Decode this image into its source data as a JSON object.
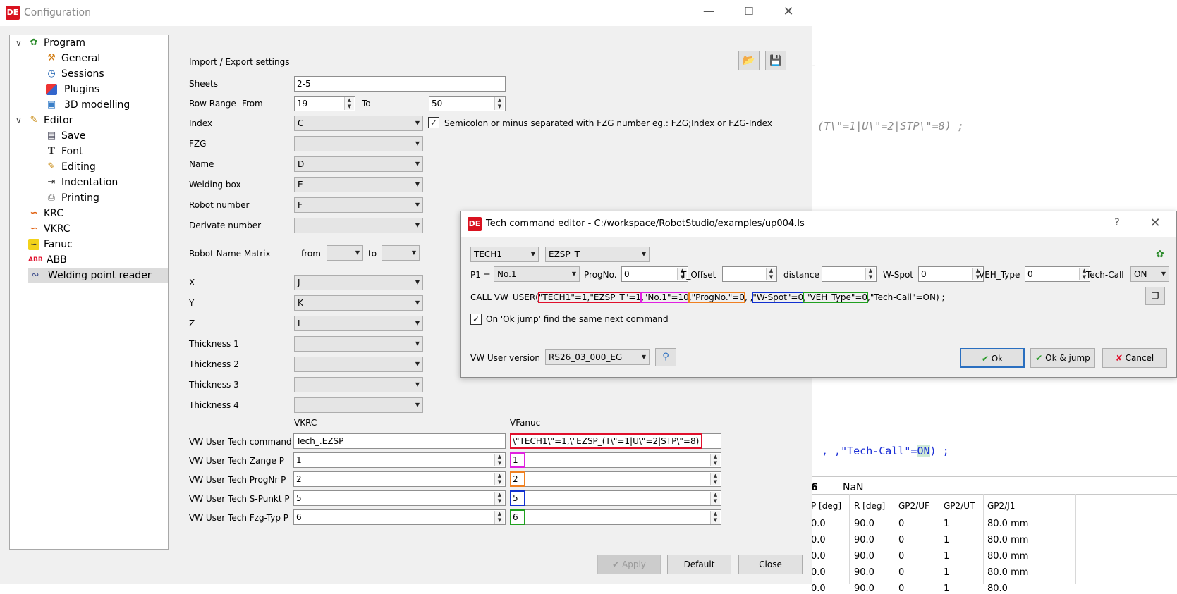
{
  "background_editor": {
    "code_line_1": "_(T\\\"=1|U\\\"=2|STP\\\"=8) ;",
    "code_line_2_prefix": ", ,\"Tech-Call\"=",
    "code_line_2_on": "ON",
    "code_line_2_suffix": ") ;",
    "dash": "-",
    "status_number": "6",
    "status_nan": "NaN",
    "grid_headers": [
      "P [deg]",
      "R [deg]",
      "GP2/UF",
      "GP2/UT",
      "GP2/J1"
    ],
    "grid_rows": [
      [
        "0.0",
        "90.0",
        "0",
        "1",
        "80.0 mm"
      ],
      [
        "0.0",
        "90.0",
        "0",
        "1",
        "80.0 mm"
      ],
      [
        "0.0",
        "90.0",
        "0",
        "1",
        "80.0 mm"
      ],
      [
        "0.0",
        "90.0",
        "0",
        "1",
        "80.0 mm"
      ],
      [
        "0.0",
        "90.0",
        "0",
        "1",
        "80.0"
      ]
    ]
  },
  "config": {
    "title": "Configuration",
    "logo": "DE",
    "tree": {
      "program": "Program",
      "general": "General",
      "sessions": "Sessions",
      "plugins": "Plugins",
      "modelling": "3D modelling",
      "editor": "Editor",
      "save": "Save",
      "font": "Font",
      "editing": "Editing",
      "indentation": "Indentation",
      "printing": "Printing",
      "krc": "KRC",
      "vkrc": "VKRC",
      "fanuc": "Fanuc",
      "abb": "ABB",
      "welding": "Welding point reader"
    },
    "form": {
      "section_title": "Import / Export settings",
      "sheets_label": "Sheets",
      "sheets_value": "2-5",
      "row_range_label": "Row Range",
      "from_label": "From",
      "from_value": "19",
      "to_label": "To",
      "to_value": "50",
      "index_label": "Index",
      "index_value": "C",
      "semicolon_text": "Semicolon or minus separated with FZG number eg.: FZG;Index or FZG-Index",
      "fzg_label": "FZG",
      "name_label": "Name",
      "name_value": "D",
      "welding_box_label": "Welding box",
      "welding_box_value": "E",
      "robot_number_label": "Robot number",
      "robot_number_value": "F",
      "derivate_label": "Derivate number",
      "robot_matrix_label": "Robot Name Matrix",
      "matrix_from": "from",
      "matrix_to": "to",
      "x_label": "X",
      "x_value": "J",
      "y_label": "Y",
      "y_value": "K",
      "z_label": "Z",
      "z_value": "L",
      "thickness1": "Thickness 1",
      "thickness2": "Thickness 2",
      "thickness3": "Thickness 3",
      "thickness4": "Thickness 4",
      "vkrc_header": "VKRC",
      "vfanuc_header": "VFanuc",
      "tech_cmd_label": "VW User Tech command",
      "tech_cmd_vkrc": "Tech_.EZSP",
      "tech_cmd_vfanuc": "\\\"TECH1\\\"=1,\\\"EZSP_(T\\\"=1|U\\\"=2|STP\\\"=8)",
      "zange_label": "VW User Tech Zange P",
      "zange_vkrc": "1",
      "zange_vfanuc": "1",
      "prognr_label": "VW User Tech ProgNr P",
      "prognr_vkrc": "2",
      "prognr_vfanuc": "2",
      "spunkt_label": "VW User Tech S-Punkt P",
      "spunkt_vkrc": "5",
      "spunkt_vfanuc": "5",
      "fzgtyp_label": "VW User Tech Fzg-Typ P",
      "fzgtyp_vkrc": "6",
      "fzgtyp_vfanuc": "6"
    },
    "buttons": {
      "apply": "Apply",
      "default": "Default",
      "close": "Close"
    }
  },
  "dialog": {
    "title": "Tech command editor - C:/workspace/RobotStudio/examples/up004.ls",
    "help": "?",
    "tech_select": "TECH1",
    "ezsp_select": "EZSP_T",
    "p1_label": "P1 =",
    "p1_value": "No.1",
    "progno_label": "ProgNo.",
    "progno_value": "0",
    "toffset_label": "T_Offset",
    "toffset_value": "",
    "distance_label": "distance",
    "distance_value": "",
    "wspot_label": "W-Spot",
    "wspot_value": "0",
    "vehtype_label": "VEH_Type",
    "vehtype_value": "0",
    "techcall_label": "Tech-Call",
    "techcall_value": "ON",
    "call_prefix": "CALL VW_USER(",
    "call_seg1": "\"TECH1\"=1,\"EZSP_T\"=1",
    "call_seg2": ",\"No.1\"=10",
    "call_seg3": ",\"ProgNo.\"=0",
    "call_mid": ", ,",
    "call_seg4": "\"W-Spot\"=0",
    "call_seg5": ",\"VEH_Type\"=0",
    "call_suffix": ",\"Tech-Call\"=ON) ;",
    "jump_text": "On 'Ok  jump' find the same next command",
    "version_label": "VW User version",
    "version_value": "RS26_03_000_EG",
    "ok": "Ok",
    "ok_jump": "Ok & jump",
    "cancel": "Cancel"
  }
}
